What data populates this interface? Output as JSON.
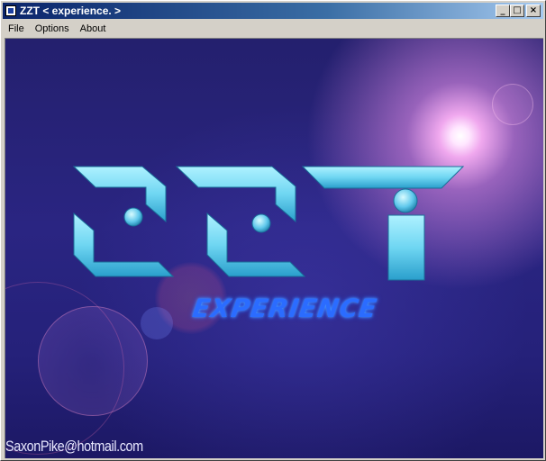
{
  "window": {
    "title": "ZZT < experience. >",
    "app_icon": "app-icon",
    "buttons": {
      "minimize": "_",
      "maximize": "□",
      "close": "×"
    }
  },
  "menu": [
    {
      "label": "File"
    },
    {
      "label": "Options"
    },
    {
      "label": "About"
    }
  ],
  "splash": {
    "logo_text": "ZZT",
    "subtitle": "experience",
    "email": "SaxonPike@hotmail.com",
    "colors": {
      "logo_cyan": "#6fd6f2",
      "subtitle_blue": "#2b6cff",
      "background_purple": "#2a2582"
    }
  }
}
